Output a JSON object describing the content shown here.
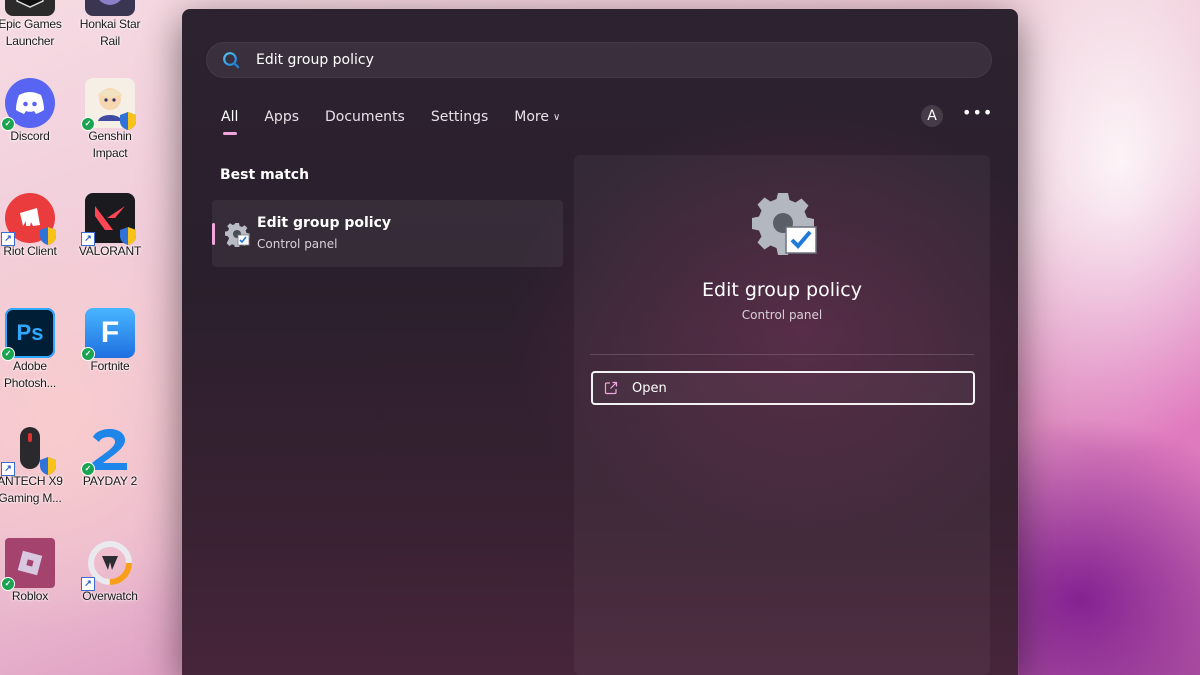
{
  "desktop": {
    "icons": [
      {
        "label": "Epic Games\nLauncher",
        "icon": "epic-games-icon"
      },
      {
        "label": "Honkai Star\nRail",
        "icon": "honkai-star-rail-icon"
      },
      {
        "label": "Discord",
        "icon": "discord-icon"
      },
      {
        "label": "Genshin\nImpact",
        "icon": "genshin-impact-icon"
      },
      {
        "label": "Riot Client",
        "icon": "riot-client-icon"
      },
      {
        "label": "VALORANT",
        "icon": "valorant-icon"
      },
      {
        "label": "Adobe\nPhotosh...",
        "icon": "photoshop-icon",
        "glyph": "Ps"
      },
      {
        "label": "Fortnite",
        "icon": "fortnite-icon",
        "glyph": "F"
      },
      {
        "label": "ANTECH X9\nGaming M...",
        "icon": "mouse-icon"
      },
      {
        "label": "PAYDAY 2",
        "icon": "payday-2-icon"
      },
      {
        "label": "Roblox",
        "icon": "roblox-icon"
      },
      {
        "label": "Overwatch",
        "icon": "overwatch-icon"
      }
    ]
  },
  "search": {
    "query": "Edit group policy",
    "tabs": [
      {
        "label": "All",
        "active": true
      },
      {
        "label": "Apps"
      },
      {
        "label": "Documents"
      },
      {
        "label": "Settings"
      },
      {
        "label": "More"
      }
    ],
    "avatar_initial": "A",
    "more_options": "•••"
  },
  "results": {
    "heading": "Best match",
    "best_match": {
      "title": "Edit group policy",
      "subtitle": "Control panel",
      "icon": "gear-check-icon"
    }
  },
  "detail": {
    "title": "Edit group policy",
    "subtitle": "Control panel",
    "action_label": "Open",
    "action_icon": "open-external-icon"
  },
  "colors": {
    "accent": "#f1a6df",
    "panel": "#2d2230"
  }
}
